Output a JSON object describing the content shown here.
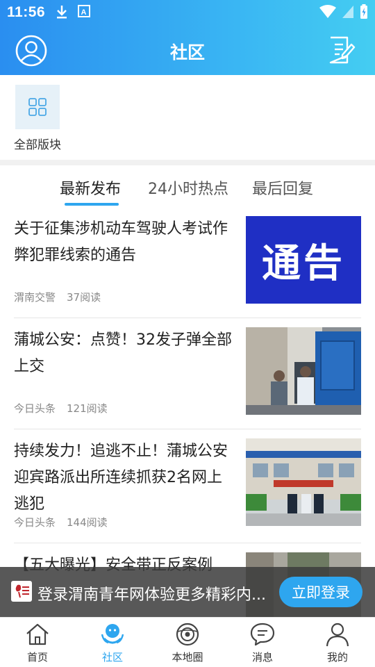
{
  "status_bar": {
    "time": "11:56"
  },
  "header": {
    "title": "社区",
    "avatar_icon": "user-circle-icon",
    "post_icon": "edit-document-icon"
  },
  "sections": {
    "all_label": "全部版块"
  },
  "tabs": [
    {
      "label": "最新发布",
      "active": true
    },
    {
      "label": "24小时热点",
      "active": false
    },
    {
      "label": "最后回复",
      "active": false
    }
  ],
  "articles": [
    {
      "title": "关于征集涉机动车驾驶人考试作弊犯罪线索的通告",
      "source": "渭南交警",
      "reads": "37阅读",
      "thumb_text": "通告"
    },
    {
      "title": "蒲城公安：点赞！32发子弹全部上交",
      "source": "今日头条",
      "reads": "121阅读"
    },
    {
      "title": "持续发力！追逃不止！蒲城公安迎宾路派出所连续抓获2名网上逃犯",
      "source": "今日头条",
      "reads": "144阅读"
    },
    {
      "title": "【五大曝光】安全带正反案例"
    }
  ],
  "login_banner": {
    "text": "登录渭南青年网体验更多精彩内...",
    "button": "立即登录"
  },
  "bottom_nav": [
    {
      "label": "首页",
      "icon": "home-icon"
    },
    {
      "label": "社区",
      "icon": "community-icon",
      "active": true
    },
    {
      "label": "本地圈",
      "icon": "local-circle-icon"
    },
    {
      "label": "消息",
      "icon": "message-icon"
    },
    {
      "label": "我的",
      "icon": "profile-icon"
    }
  ],
  "colors": {
    "accent": "#2ea6ef",
    "header_start": "#2a8ef0",
    "header_end": "#44cdf2",
    "notice_blue": "#1f2fc4"
  }
}
